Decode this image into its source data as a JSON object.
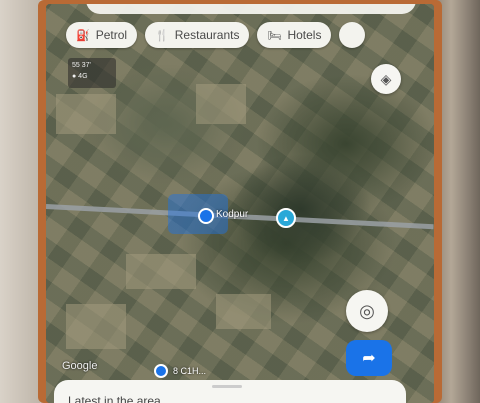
{
  "chips": [
    {
      "icon": "fuel-icon",
      "glyph": "⛽",
      "label": "Petrol"
    },
    {
      "icon": "restaurant-icon",
      "glyph": "🍴",
      "label": "Restaurants"
    },
    {
      "icon": "hotel-icon",
      "glyph": "🛏",
      "label": "Hotels"
    }
  ],
  "info_box": {
    "line1": "55 37'",
    "line2": "● 4G"
  },
  "map": {
    "place_label": "Kodpur",
    "attribution": "Google",
    "plus_code": "8 C1H..."
  },
  "sheet": {
    "title": "Latest in the area"
  },
  "colors": {
    "accent": "#1a73e8",
    "chip_bg": "#f3f3ee"
  }
}
